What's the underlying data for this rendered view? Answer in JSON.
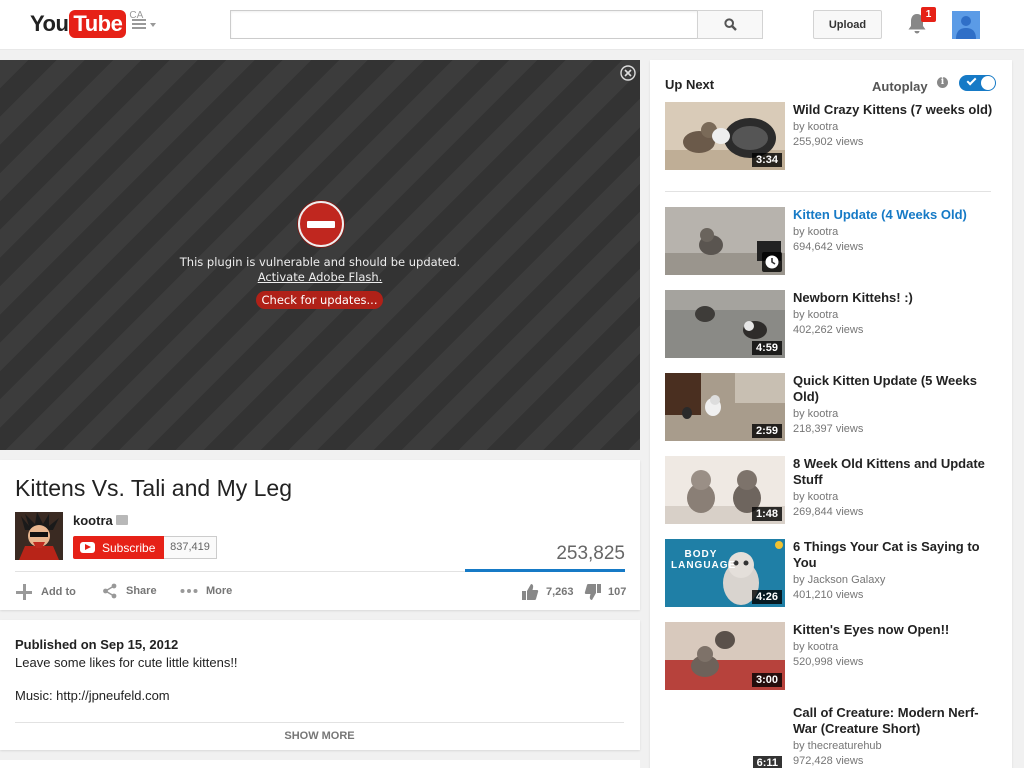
{
  "header": {
    "logo_you": "You",
    "logo_tube": "Tube",
    "country": "CA",
    "search_placeholder": "",
    "upload_label": "Upload",
    "notification_count": "1",
    "brand_color": "#e62117"
  },
  "player": {
    "message": "This plugin is vulnerable and should be updated.",
    "activate_link": "Activate Adobe Flash.",
    "check_button": "Check for updates..."
  },
  "video": {
    "title": "Kittens Vs. Tali and My Leg",
    "channel": "kootra",
    "subscribe_label": "Subscribe",
    "subscriber_count": "837,419",
    "views": "253,825",
    "actions": {
      "add_to": "Add to",
      "share": "Share",
      "more": "More"
    },
    "likes": "7,263",
    "dislikes": "107",
    "accent_color": "#167ac6"
  },
  "description": {
    "published": "Published on Sep 15, 2012",
    "line1": "Leave some likes for cute little kittens!!",
    "line2": "Music: http://jpneufeld.com",
    "show_more": "SHOW MORE"
  },
  "sidebar": {
    "up_next": "Up Next",
    "autoplay": "Autoplay",
    "autoplay_on": true,
    "videos": [
      {
        "title": "Wild Crazy Kittens (7 weeks old)",
        "channel": "by kootra",
        "views": "255,902 views",
        "duration": "3:34"
      },
      {
        "title": "Kitten Update (4 Weeks Old)",
        "channel": "by kootra",
        "views": "694,642 views",
        "duration": ""
      },
      {
        "title": "Newborn Kittehs! :)",
        "channel": "by kootra",
        "views": "402,262 views",
        "duration": "4:59"
      },
      {
        "title": "Quick Kitten Update (5 Weeks Old)",
        "channel": "by kootra",
        "views": "218,397 views",
        "duration": "2:59"
      },
      {
        "title": "8 Week Old Kittens and Update Stuff",
        "channel": "by kootra",
        "views": "269,844 views",
        "duration": "1:48"
      },
      {
        "title": "6 Things Your Cat is Saying to You",
        "channel": "by Jackson Galaxy",
        "views": "401,210 views",
        "duration": "4:26",
        "thumb_text": "BODY LANGUAGE"
      },
      {
        "title": "Kitten's Eyes now Open!!",
        "channel": "by kootra",
        "views": "520,998 views",
        "duration": "3:00"
      },
      {
        "title": "Call of Creature: Modern Nerf-War (Creature Short)",
        "channel": "by thecreaturehub",
        "views": "972,428 views",
        "duration": "6:11"
      }
    ]
  }
}
